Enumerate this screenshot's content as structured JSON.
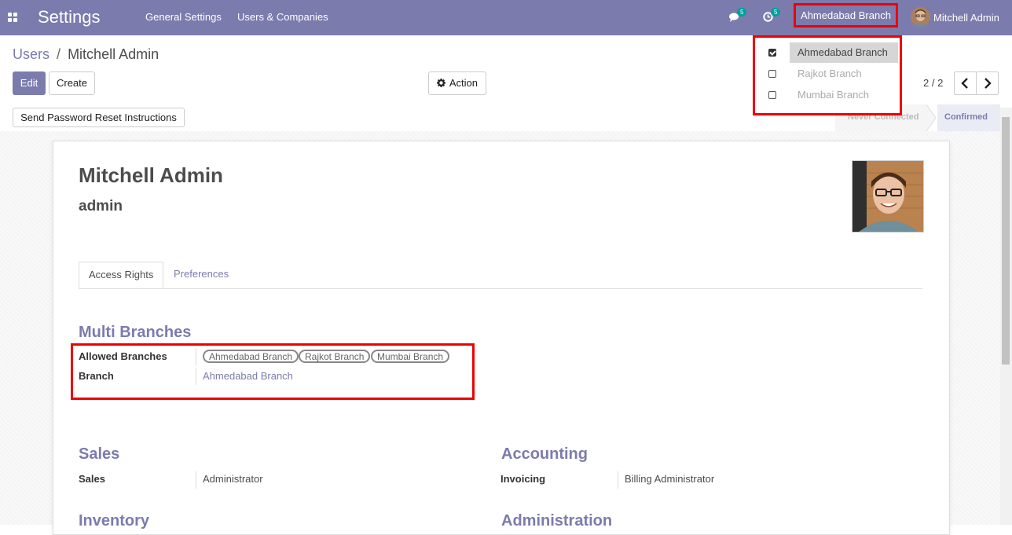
{
  "navbar": {
    "app_title": "Settings",
    "menu": [
      "General Settings",
      "Users & Companies"
    ],
    "messages_badge": "5",
    "activities_badge": "5",
    "current_branch": "Ahmedabad Branch",
    "user_name": "Mitchell Admin"
  },
  "breadcrumb": {
    "parent": "Users",
    "separator": "/",
    "current": "Mitchell Admin"
  },
  "toolbar": {
    "edit_label": "Edit",
    "create_label": "Create",
    "action_label": "Action"
  },
  "pager": {
    "value": "2 / 2"
  },
  "statusbar": {
    "reset_label": "Send Password Reset Instructions",
    "stages": [
      "Never Connected",
      "Confirmed"
    ]
  },
  "branch_dropdown": [
    {
      "label": "Ahmedabad Branch",
      "checked": true
    },
    {
      "label": "Rajkot Branch",
      "checked": false
    },
    {
      "label": "Mumbai Branch",
      "checked": false
    }
  ],
  "form": {
    "name": "Mitchell Admin",
    "login": "admin",
    "tabs": [
      "Access Rights",
      "Preferences"
    ],
    "multi_branches": {
      "title": "Multi Branches",
      "allowed_label": "Allowed Branches",
      "allowed_tags": [
        "Ahmedabad Branch",
        "Rajkot Branch",
        "Mumbai Branch"
      ],
      "branch_label": "Branch",
      "branch_value": "Ahmedabad Branch"
    },
    "sales": {
      "title": "Sales",
      "label": "Sales",
      "value": "Administrator"
    },
    "accounting": {
      "title": "Accounting",
      "label": "Invoicing",
      "value": "Billing Administrator"
    },
    "inventory": {
      "title": "Inventory"
    },
    "administration": {
      "title": "Administration"
    }
  },
  "colors": {
    "brand": "#7c7bad",
    "highlight": "#e00000",
    "badge": "#00a09d"
  }
}
